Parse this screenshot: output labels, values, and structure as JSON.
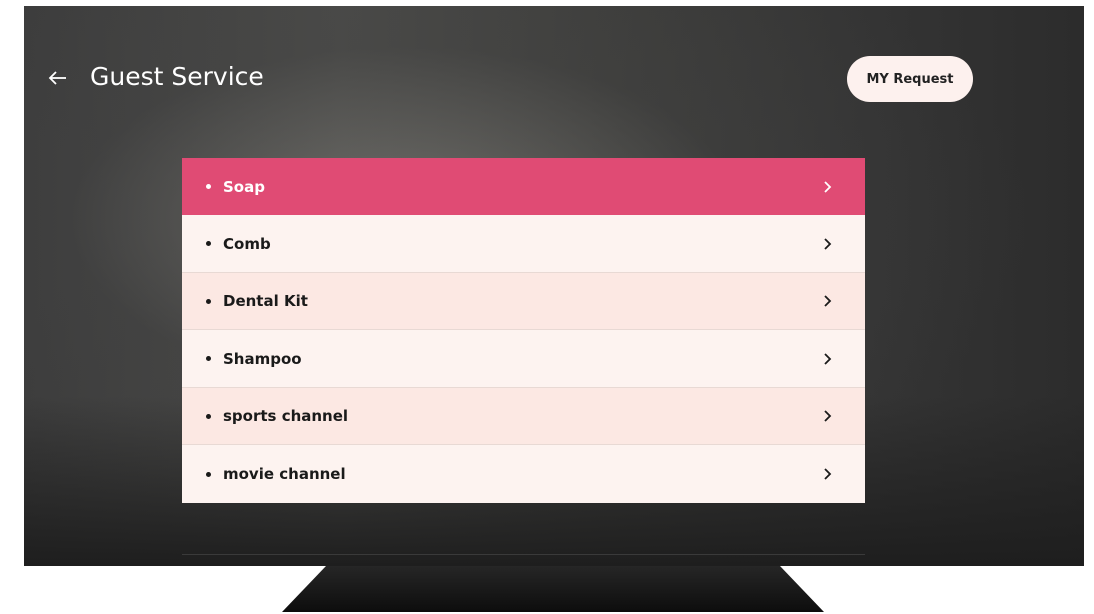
{
  "header": {
    "title": "Guest Service",
    "my_request_label": "MY Request"
  },
  "list": {
    "items": [
      {
        "label": "Soap",
        "selected": true
      },
      {
        "label": "Comb",
        "selected": false
      },
      {
        "label": "Dental Kit",
        "selected": false
      },
      {
        "label": "Shampoo",
        "selected": false
      },
      {
        "label": "sports channel",
        "selected": false
      },
      {
        "label": "movie channel",
        "selected": false
      }
    ]
  },
  "colors": {
    "accent": "#e04b74",
    "row_light": "#fdf3f0",
    "row_tint": "#fce8e3",
    "button_bg": "#fdf1ee"
  },
  "icons": {
    "back": "arrow-left-icon",
    "row_action": "chevron-right-icon"
  }
}
